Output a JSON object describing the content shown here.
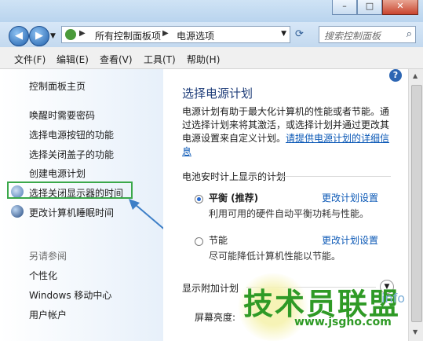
{
  "window": {
    "minimize_icon": "minimize-icon",
    "maximize_icon": "maximize-icon",
    "close_icon": "close-icon"
  },
  "nav": {
    "breadcrumb": [
      "所有控制面板项",
      "电源选项"
    ],
    "search_placeholder": "搜索控制面板"
  },
  "menu": {
    "items": [
      "文件(F)",
      "编辑(E)",
      "查看(V)",
      "工具(T)",
      "帮助(H)"
    ]
  },
  "sidebar": {
    "home": "控制面板主页",
    "links": [
      "唤醒时需要密码",
      "选择电源按钮的功能",
      "选择关闭盖子的功能",
      "创建电源计划",
      "选择关闭显示器的时间",
      "更改计算机睡眠时间"
    ],
    "see_also_title": "另请参阅",
    "see_also": [
      "个性化",
      "Windows 移动中心",
      "用户帐户"
    ]
  },
  "main": {
    "title": "选择电源计划",
    "desc": "电源计划有助于最大化计算机的性能或者节能。通过选择计划来将其激活，或选择计划并通过更改其电源设置来自定义计划。",
    "desc_link": "请提供电源计划的详细信息",
    "section_battery": "电池安时计上显示的计划",
    "plans": [
      {
        "name": "平衡 (推荐)",
        "desc": "利用可用的硬件自动平衡功耗与性能。",
        "change": "更改计划设置",
        "selected": true
      },
      {
        "name": "节能",
        "desc": "尽可能降低计算机性能以节能。",
        "change": "更改计划设置",
        "selected": false
      }
    ],
    "section_additional": "显示附加计划",
    "brightness_label": "屏幕亮度:"
  },
  "watermark": {
    "text": "技术员联盟",
    "url": "www.jsgho.com",
    "suffix": "info"
  }
}
